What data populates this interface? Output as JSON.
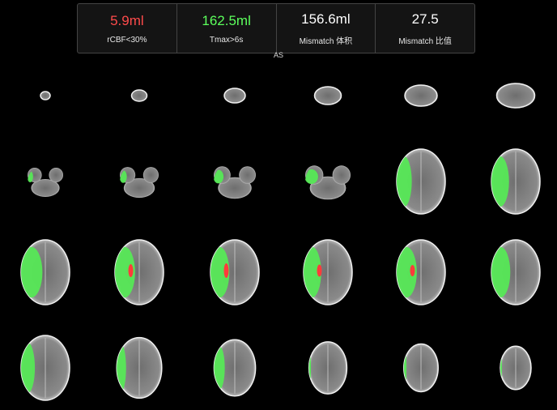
{
  "summary": {
    "metrics": [
      {
        "value": "5.9ml",
        "label": "rCBF<30%",
        "color": "#ff4b4b"
      },
      {
        "value": "162.5ml",
        "label": "Tmax>6s",
        "color": "#5cff5c"
      },
      {
        "value": "156.6ml",
        "label": "Mismatch 体积",
        "color": "#ffffff"
      },
      {
        "value": "27.5",
        "label": "Mismatch 比值",
        "color": "#ffffff"
      }
    ]
  },
  "orientation_label": "AS",
  "colors": {
    "core": "#ff3b3b",
    "penumbra": "#56e856",
    "tissue": "#8a8a8a",
    "background": "#000000"
  },
  "slices": {
    "rows": 4,
    "columns": 6,
    "items": [
      {
        "index": 1,
        "shape": "small",
        "penumbra": 0,
        "core": 0
      },
      {
        "index": 2,
        "shape": "small",
        "penumbra": 0,
        "core": 0
      },
      {
        "index": 3,
        "shape": "small",
        "penumbra": 0,
        "core": 0
      },
      {
        "index": 4,
        "shape": "small",
        "penumbra": 0,
        "core": 0
      },
      {
        "index": 5,
        "shape": "small",
        "penumbra": 0,
        "core": 0
      },
      {
        "index": 6,
        "shape": "small",
        "penumbra": 0,
        "core": 0
      },
      {
        "index": 7,
        "shape": "skullbase",
        "penumbra": 0.3,
        "core": 0
      },
      {
        "index": 8,
        "shape": "skullbase",
        "penumbra": 0.35,
        "core": 0
      },
      {
        "index": 9,
        "shape": "skullbase",
        "penumbra": 0.45,
        "core": 0
      },
      {
        "index": 10,
        "shape": "skullbase",
        "penumbra": 0.55,
        "core": 0
      },
      {
        "index": 11,
        "shape": "full",
        "penumbra": 0.6,
        "core": 0
      },
      {
        "index": 12,
        "shape": "full",
        "penumbra": 0.7,
        "core": 0
      },
      {
        "index": 13,
        "shape": "full",
        "penumbra": 0.85,
        "core": 0
      },
      {
        "index": 14,
        "shape": "full",
        "penumbra": 0.8,
        "core": 0.4
      },
      {
        "index": 15,
        "shape": "full",
        "penumbra": 0.75,
        "core": 0.5
      },
      {
        "index": 16,
        "shape": "full",
        "penumbra": 0.7,
        "core": 0.35
      },
      {
        "index": 17,
        "shape": "full",
        "penumbra": 0.8,
        "core": 0.3
      },
      {
        "index": 18,
        "shape": "full",
        "penumbra": 0.75,
        "core": 0
      },
      {
        "index": 19,
        "shape": "full",
        "penumbra": 0.55,
        "core": 0
      },
      {
        "index": 20,
        "shape": "full",
        "penumbra": 0.4,
        "core": 0
      },
      {
        "index": 21,
        "shape": "full",
        "penumbra": 0.5,
        "core": 0
      },
      {
        "index": 22,
        "shape": "full",
        "penumbra": 0.1,
        "core": 0
      },
      {
        "index": 23,
        "shape": "full",
        "penumbra": 0.15,
        "core": 0
      },
      {
        "index": 24,
        "shape": "full",
        "penumbra": 0.1,
        "core": 0
      }
    ]
  }
}
